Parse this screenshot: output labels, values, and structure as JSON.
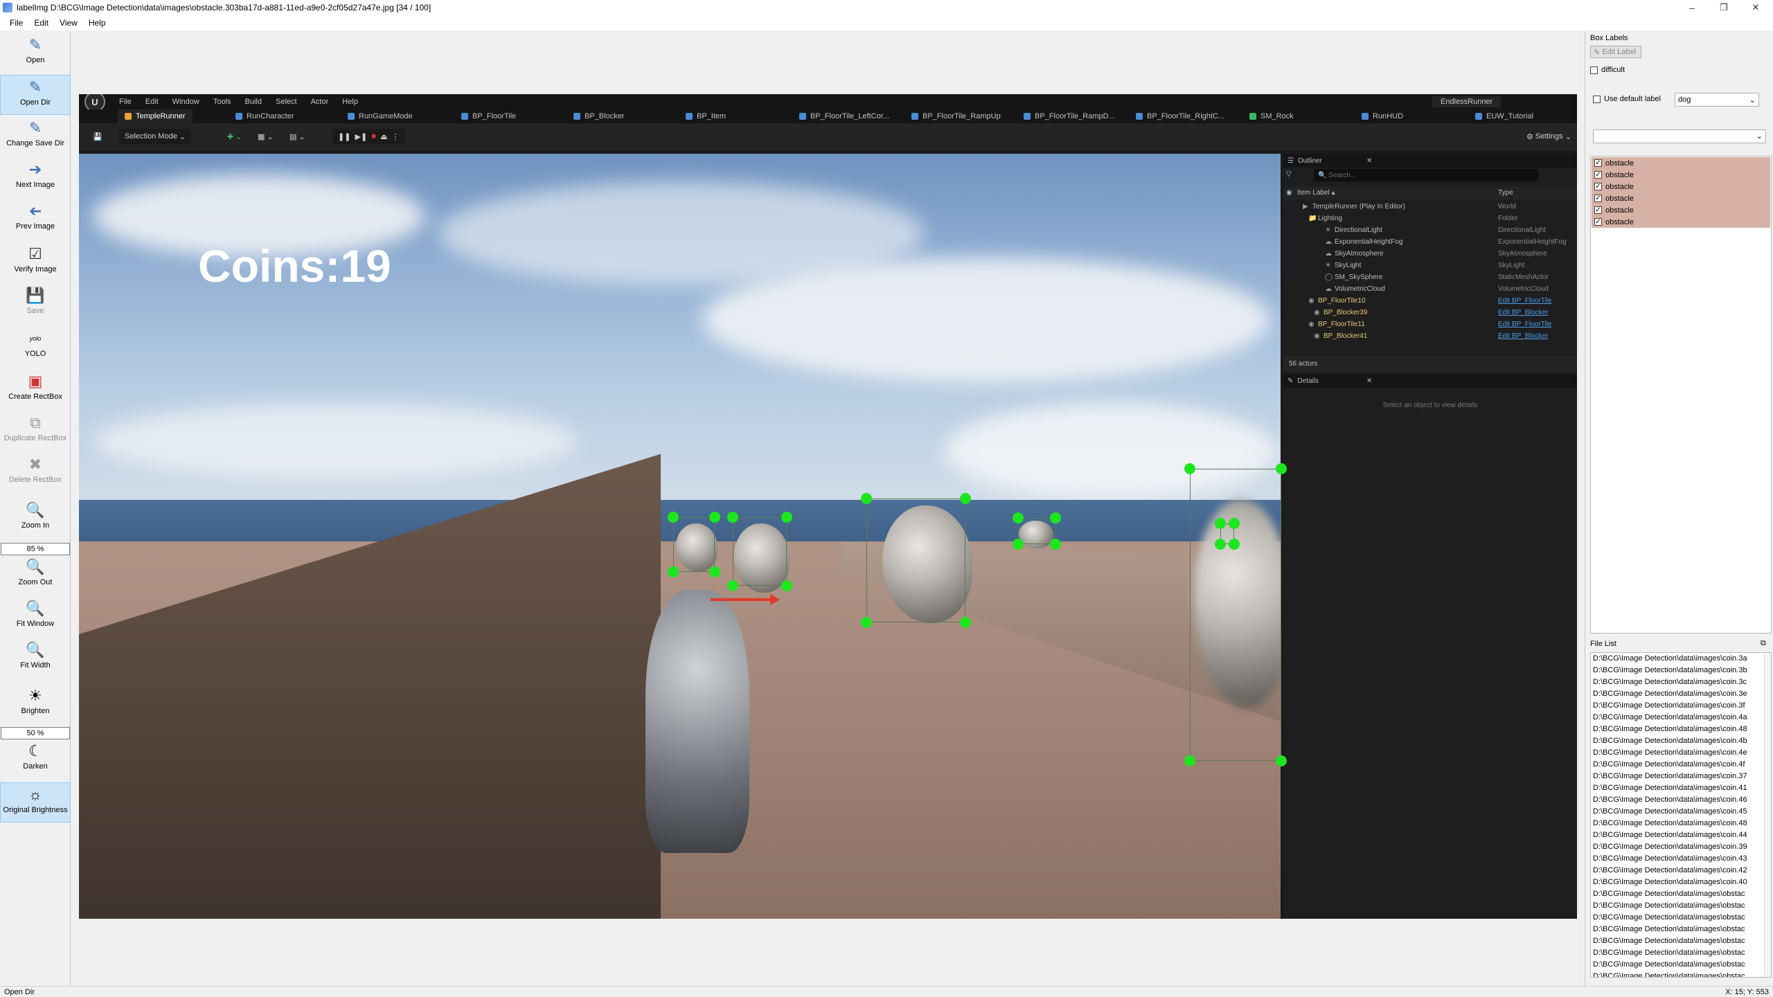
{
  "window": {
    "title": "labelImg D:\\BCG\\Image Detection\\data\\images\\obstacle.303ba17d-a881-11ed-a9e0-2cf05d27a47e.jpg [34 / 100]"
  },
  "menubar": [
    "File",
    "Edit",
    "View",
    "Help"
  ],
  "toolbar": {
    "open": "Open",
    "open_dir": "Open Dir",
    "change_save_dir": "Change Save Dir",
    "next_image": "Next Image",
    "prev_image": "Prev Image",
    "verify_image": "Verify Image",
    "save": "Save",
    "yolo": "YOLO",
    "yolo_icon_text": "yolo",
    "create_rectbox": "Create RectBox",
    "duplicate_rectbox": "Duplicate RectBox",
    "delete_rectbox": "Delete RectBox",
    "zoom_in": "Zoom In",
    "zoom_value": "85 %",
    "zoom_out": "Zoom Out",
    "fit_window": "Fit Window",
    "fit_width": "Fit Width",
    "brighten": "Brighten",
    "brightness_value": "50 %",
    "darken": "Darken",
    "original_brightness": "Original Brightness"
  },
  "editor": {
    "menu": [
      "File",
      "Edit",
      "Window",
      "Tools",
      "Build",
      "Select",
      "Actor",
      "Help"
    ],
    "project": "EndlessRunner",
    "tabs": [
      "TempleRunner",
      "RunCharacter",
      "RunGameMode",
      "BP_FloorTile",
      "BP_Blocker",
      "BP_Item",
      "BP_FloorTile_LeftCor...",
      "BP_FloorTile_RampUp",
      "BP_FloorTile_RampD...",
      "BP_FloorTile_RightC...",
      "SM_Rock",
      "RunHUD",
      "EUW_Tutorial"
    ],
    "selection_mode": "Selection Mode",
    "settings": "Settings",
    "hud_coins": "Coins:19",
    "outliner": {
      "title": "Outliner",
      "search_placeholder": "Search...",
      "col_label": "Item Label ▴",
      "col_type": "Type",
      "rows": [
        {
          "label": "TempleRunner (Play In Editor)",
          "type": "World"
        },
        {
          "label": "Lighting",
          "type": "Folder"
        },
        {
          "label": "DirectionalLight",
          "type": "DirectionalLight"
        },
        {
          "label": "ExponentialHeightFog",
          "type": "ExponentialHeightFog"
        },
        {
          "label": "SkyAtmosphere",
          "type": "SkyAtmosphere"
        },
        {
          "label": "SkyLight",
          "type": "SkyLight"
        },
        {
          "label": "SM_SkySphere",
          "type": "StaticMeshActor"
        },
        {
          "label": "VolumetricCloud",
          "type": "VolumetricCloud"
        },
        {
          "label": "BP_FloorTile10",
          "type": "Edit BP_FloorTile"
        },
        {
          "label": "BP_Blocker39",
          "type": "Edit BP_Blocker"
        },
        {
          "label": "BP_FloorTile11",
          "type": "Edit BP_FloorTile"
        },
        {
          "label": "BP_Blocker41",
          "type": "Edit BP_Blocker"
        }
      ],
      "actor_count": "56 actors"
    },
    "details": {
      "title": "Details",
      "empty_text": "Select an object to view details"
    }
  },
  "right_panel": {
    "box_labels_title": "Box Labels",
    "edit_label": "Edit Label",
    "difficult": "difficult",
    "use_default_label": "Use default label",
    "default_label_value": "dog",
    "labels": [
      "obstacle",
      "obstacle",
      "obstacle",
      "obstacle",
      "obstacle",
      "obstacle"
    ],
    "file_list_title": "File List",
    "files": [
      "D:\\BCG\\Image Detection\\data\\images\\coin.3a",
      "D:\\BCG\\Image Detection\\data\\images\\coin.3b",
      "D:\\BCG\\Image Detection\\data\\images\\coin.3c",
      "D:\\BCG\\Image Detection\\data\\images\\coin.3e",
      "D:\\BCG\\Image Detection\\data\\images\\coin.3f",
      "D:\\BCG\\Image Detection\\data\\images\\coin.4a",
      "D:\\BCG\\Image Detection\\data\\images\\coin.48",
      "D:\\BCG\\Image Detection\\data\\images\\coin.4b",
      "D:\\BCG\\Image Detection\\data\\images\\coin.4e",
      "D:\\BCG\\Image Detection\\data\\images\\coin.4f",
      "D:\\BCG\\Image Detection\\data\\images\\coin.37",
      "D:\\BCG\\Image Detection\\data\\images\\coin.41",
      "D:\\BCG\\Image Detection\\data\\images\\coin.46",
      "D:\\BCG\\Image Detection\\data\\images\\coin.45",
      "D:\\BCG\\Image Detection\\data\\images\\coin.48",
      "D:\\BCG\\Image Detection\\data\\images\\coin.44",
      "D:\\BCG\\Image Detection\\data\\images\\coin.39",
      "D:\\BCG\\Image Detection\\data\\images\\coin.43",
      "D:\\BCG\\Image Detection\\data\\images\\coin.42",
      "D:\\BCG\\Image Detection\\data\\images\\coin.40",
      "D:\\BCG\\Image Detection\\data\\images\\obstac",
      "D:\\BCG\\Image Detection\\data\\images\\obstac",
      "D:\\BCG\\Image Detection\\data\\images\\obstac",
      "D:\\BCG\\Image Detection\\data\\images\\obstac",
      "D:\\BCG\\Image Detection\\data\\images\\obstac",
      "D:\\BCG\\Image Detection\\data\\images\\obstac",
      "D:\\BCG\\Image Detection\\data\\images\\obstac",
      "D:\\BCG\\Image Detection\\data\\images\\obstac"
    ]
  },
  "status": {
    "message": "Open Dir",
    "coords": "X: 15; Y: 553"
  },
  "colors": {
    "label_bg": "#d7b1a5",
    "handle": "#1ee61e",
    "active_tool": "#cce4f7",
    "link": "#4a9be8"
  }
}
